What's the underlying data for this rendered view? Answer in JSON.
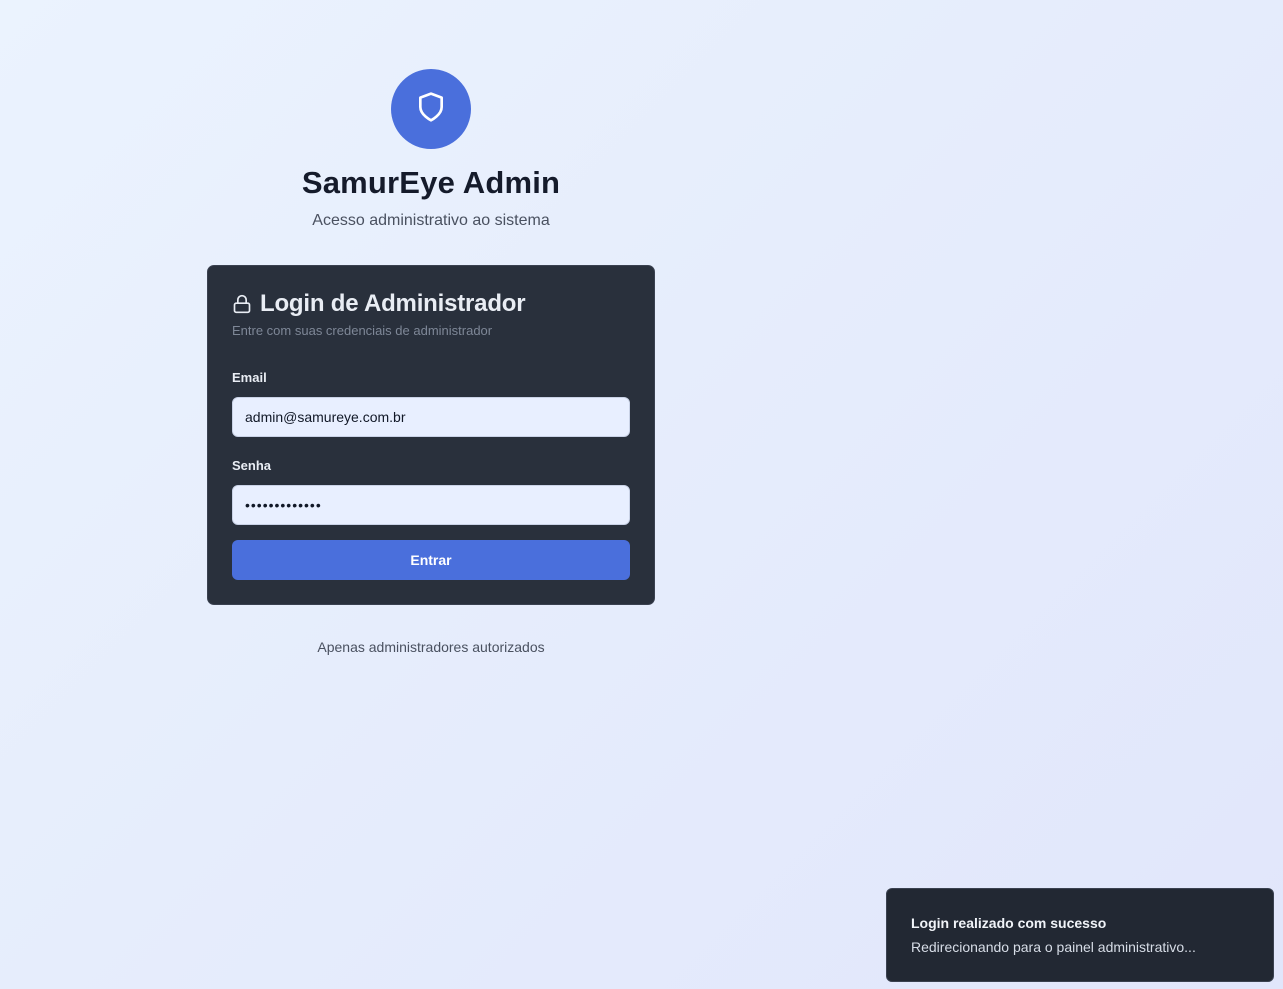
{
  "brand": {
    "icon": "shield-icon",
    "title": "SamurEye Admin",
    "subtitle": "Acesso administrativo ao sistema"
  },
  "login_card": {
    "icon": "lock-icon",
    "title": "Login de Administrador",
    "description": "Entre com suas credenciais de administrador",
    "email_label": "Email",
    "email_value": "admin@samureye.com.br",
    "password_label": "Senha",
    "password_value": "•••••••••••••",
    "submit_label": "Entrar"
  },
  "footer": {
    "note": "Apenas administradores autorizados"
  },
  "toast": {
    "title": "Login realizado com sucesso",
    "description": "Redirecionando para o painel administrativo..."
  },
  "colors": {
    "accent": "#4a6fdc",
    "card_background": "#29303c",
    "toast_background": "#222833"
  }
}
